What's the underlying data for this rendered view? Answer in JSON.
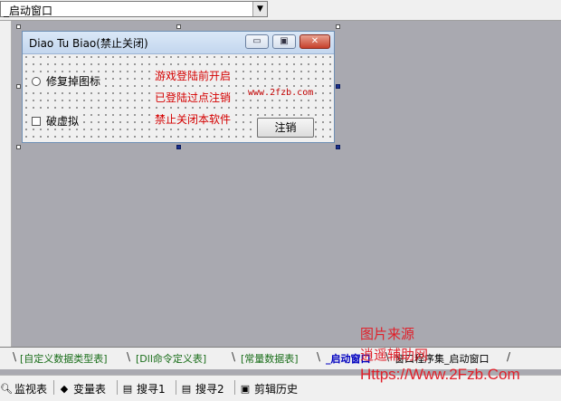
{
  "toolbar": {
    "combo_value": "_启动窗口"
  },
  "form": {
    "title": "Diao Tu Biao(禁止关闭)",
    "min_glyph": "▭",
    "max_glyph": "▣",
    "close_glyph": "✕",
    "radio_label": "修复掉图标",
    "check_label": "破虚拟",
    "red_labels": [
      "游戏登陆前开启",
      "已登陆过点注销",
      "禁止关闭本软件"
    ],
    "website": "www.2fzb.com",
    "logout_button": "注销"
  },
  "tabs": [
    {
      "label": "[自定义数据类型表]"
    },
    {
      "label": "[Dll命令定义表]"
    },
    {
      "label": "[常量数据表]"
    },
    {
      "label": "_启动窗口"
    },
    {
      "label": "窗口程序集_启动窗口"
    }
  ],
  "bottom": [
    {
      "label": "监视表",
      "icon": "magnifier-icon"
    },
    {
      "label": "变量表",
      "icon": "variables-icon"
    },
    {
      "label": "搜寻1",
      "icon": "search-doc-icon"
    },
    {
      "label": "搜寻2",
      "icon": "search-doc-icon"
    },
    {
      "label": "剪辑历史",
      "icon": "clipboard-icon"
    }
  ],
  "watermark": {
    "line1": "图片来源",
    "line2": "逍遥辅助网",
    "line3": "Https://Www.2Fzb.Com"
  },
  "colors": {
    "accent_red": "#d40000",
    "canvas": "#a9a9b0",
    "active_tab": "#0000c0"
  }
}
